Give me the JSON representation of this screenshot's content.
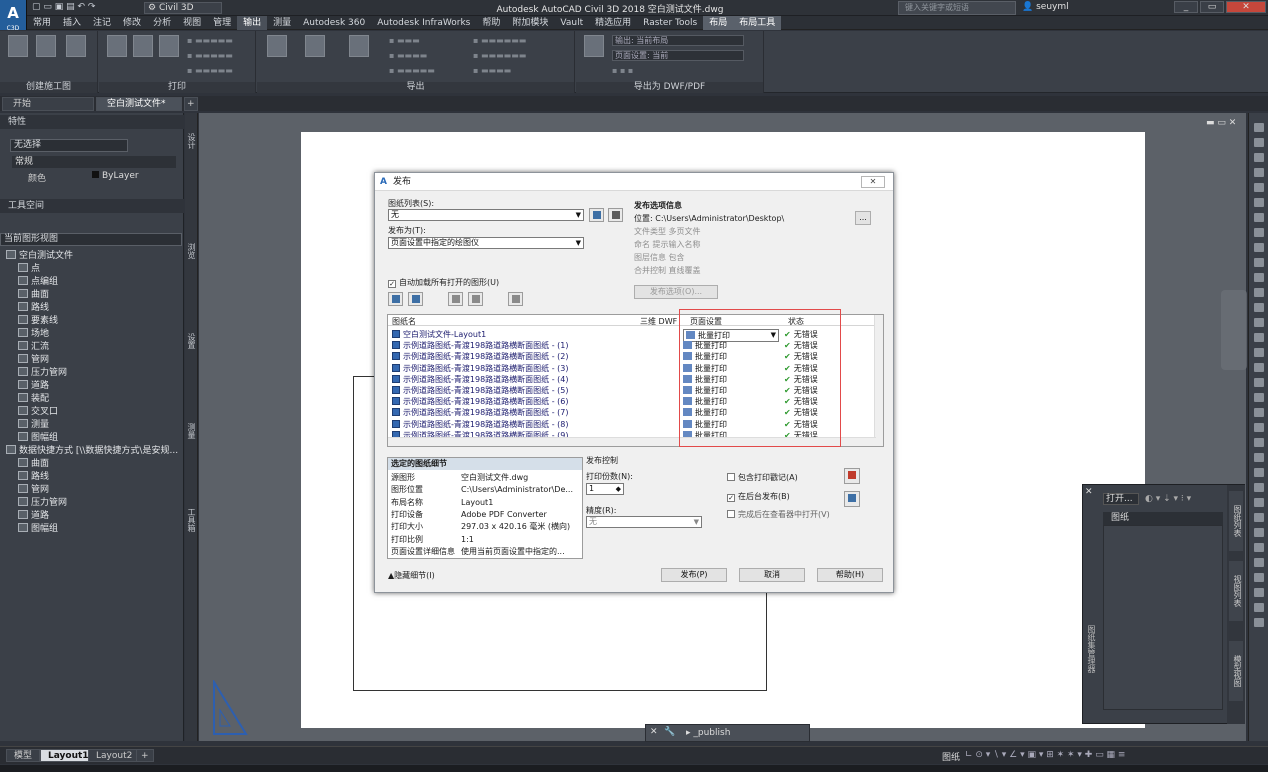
{
  "titlebar": {
    "app_letter": "A",
    "app_sub": "C3D",
    "workspace": "Civil 3D",
    "title": "Autodesk AutoCAD Civil 3D 2018    空白测试文件.dwg",
    "search_placeholder": "键入关键字或短语",
    "username": "seuyml"
  },
  "menus": [
    "常用",
    "插入",
    "注记",
    "修改",
    "分析",
    "视图",
    "管理",
    "输出",
    "测量",
    "Autodesk 360",
    "Autodesk InfraWorks",
    "帮助",
    "附加模块",
    "Vault",
    "精选应用",
    "Raster Tools",
    "布局",
    "布局工具"
  ],
  "ribbon": {
    "groups": [
      "创建施工图",
      "打印",
      "导出",
      "导出为 DWF/PDF"
    ],
    "output_label": "输出: 当前布局",
    "page_setup_label": "页面设置: 当前"
  },
  "doc_tabs": [
    "开始",
    "空白测试文件*"
  ],
  "left": {
    "prop_title": "特性",
    "no_selection": "无选择",
    "general": "常规",
    "color_label": "颜色",
    "color_value": "ByLayer",
    "toolspace_title": "工具空间",
    "view_combo": "当前图形视图",
    "vert_tabs": [
      "设计",
      "浏览",
      "设置",
      "测量",
      "工具箱"
    ],
    "tree": [
      {
        "label": "空白测试文件",
        "indent": 0
      },
      {
        "label": "点",
        "indent": 2
      },
      {
        "label": "点编组",
        "indent": 2
      },
      {
        "label": "曲面",
        "indent": 2
      },
      {
        "label": "路线",
        "indent": 2
      },
      {
        "label": "要素线",
        "indent": 2
      },
      {
        "label": "场地",
        "indent": 2
      },
      {
        "label": "汇流",
        "indent": 2
      },
      {
        "label": "管网",
        "indent": 2
      },
      {
        "label": "压力管网",
        "indent": 2
      },
      {
        "label": "道路",
        "indent": 2
      },
      {
        "label": "装配",
        "indent": 2
      },
      {
        "label": "交叉口",
        "indent": 2
      },
      {
        "label": "测量",
        "indent": 2
      },
      {
        "label": "图幅组",
        "indent": 2
      },
      {
        "label": "数据快捷方式 [\\\\数据快捷方式\\是安规...",
        "indent": 0
      },
      {
        "label": "曲面",
        "indent": 2
      },
      {
        "label": "路线",
        "indent": 2
      },
      {
        "label": "管网",
        "indent": 2
      },
      {
        "label": "压力管网",
        "indent": 2
      },
      {
        "label": "道路",
        "indent": 2
      },
      {
        "label": "图幅组",
        "indent": 2
      }
    ]
  },
  "dialog": {
    "title": "发布",
    "sheet_list_label": "图纸列表(S):",
    "sheet_list_value": "无",
    "publish_to_label": "发布为(T):",
    "publish_to_value": "页面设置中指定的绘图仪",
    "auto_load": "自动加载所有打开的图形(U)",
    "pub_options_header": "发布选项信息",
    "location": "位置: C:\\Users\\Administrator\\Desktop\\",
    "file_type": "文件类型  多页文件",
    "naming": "命名  提示输入名称",
    "layer_info": "图层信息  包含",
    "merge": "合并控制  直线覆盖",
    "publish_options_btn": "发布选项(O)...",
    "col_name": "图纸名",
    "col_3d": "三维 DWF",
    "col_page": "页面设置",
    "col_status": "状态",
    "sheets": [
      {
        "name": "空白测试文件-Layout1",
        "page": "批量打印",
        "status": "无错误"
      },
      {
        "name": "示例道路图纸-青渡198路道路横断面图纸 - (1)",
        "page": "批量打印",
        "status": "无错误"
      },
      {
        "name": "示例道路图纸-青渡198路道路横断面图纸 - (2)",
        "page": "批量打印",
        "status": "无错误"
      },
      {
        "name": "示例道路图纸-青渡198路道路横断面图纸 - (3)",
        "page": "批量打印",
        "status": "无错误"
      },
      {
        "name": "示例道路图纸-青渡198路道路横断面图纸 - (4)",
        "page": "批量打印",
        "status": "无错误"
      },
      {
        "name": "示例道路图纸-青渡198路道路横断面图纸 - (5)",
        "page": "批量打印",
        "status": "无错误"
      },
      {
        "name": "示例道路图纸-青渡198路道路横断面图纸 - (6)",
        "page": "批量打印",
        "status": "无错误"
      },
      {
        "name": "示例道路图纸-青渡198路道路横断面图纸 - (7)",
        "page": "批量打印",
        "status": "无错误"
      },
      {
        "name": "示例道路图纸-青渡198路道路横断面图纸 - (8)",
        "page": "批量打印",
        "status": "无错误"
      },
      {
        "name": "示例道路图纸-青渡198路道路横断面图纸 - (9)",
        "page": "批量打印",
        "status": "无错误"
      }
    ],
    "details_header": "选定的图纸细节",
    "details": [
      {
        "k": "源图形",
        "v": "空白测试文件.dwg"
      },
      {
        "k": "图形位置",
        "v": "C:\\Users\\Administrator\\De..."
      },
      {
        "k": "布局名称",
        "v": "Layout1"
      },
      {
        "k": "打印设备",
        "v": "Adobe PDF Converter"
      },
      {
        "k": "打印大小",
        "v": "297.03 x 420.16 毫米 (横向)"
      },
      {
        "k": "打印比例",
        "v": "1:1"
      },
      {
        "k": "页面设置详细信息",
        "v": "使用当前页面设置中指定的..."
      }
    ],
    "pub_control": "发布控制",
    "copies_label": "打印份数(N):",
    "copies_value": "1",
    "precision_label": "精度(R):",
    "precision_value": "无",
    "include_stamp": "包含打印戳记(A)",
    "background": "在后台发布(B)",
    "open_viewer": "完成后在查看器中打开(V)",
    "hide_details": "隐藏细节(I)",
    "publish_btn": "发布(P)",
    "cancel_btn": "取消",
    "help_btn": "帮助(H)"
  },
  "float_palette": {
    "open_btn": "打开...",
    "sheets_label": "图纸",
    "side_tabs": [
      "图纸列表",
      "视图列表",
      "模型视图"
    ],
    "side_title": "图纸集管理器"
  },
  "command": {
    "text": "_publish"
  },
  "status": {
    "tabs": [
      "模型",
      "Layout1",
      "Layout2"
    ],
    "paper": "图纸"
  }
}
